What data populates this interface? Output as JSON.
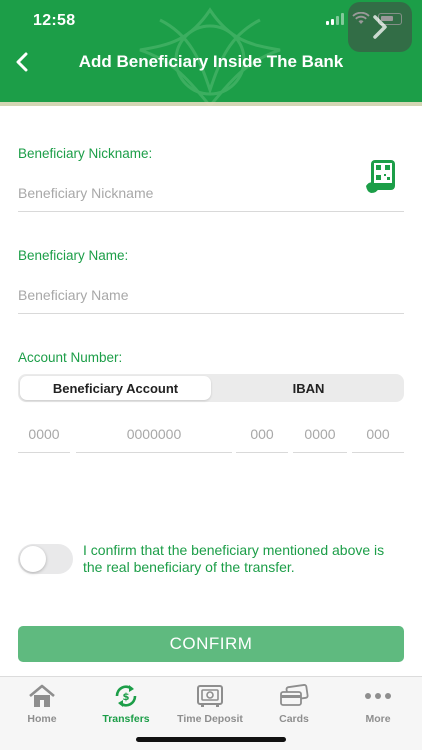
{
  "status_bar": {
    "time": "12:58"
  },
  "header": {
    "title": "Add Beneficiary Inside The Bank"
  },
  "form": {
    "nickname": {
      "label": "Beneficiary Nickname:",
      "placeholder": "Beneficiary Nickname"
    },
    "name": {
      "label": "Beneficiary Name:",
      "placeholder": "Beneficiary Name"
    },
    "account": {
      "label": "Account Number:",
      "segments": [
        {
          "label": "Beneficiary Account",
          "selected": true
        },
        {
          "label": "IBAN",
          "selected": false
        }
      ],
      "parts": [
        {
          "placeholder": "0000"
        },
        {
          "placeholder": "0000000"
        },
        {
          "placeholder": "000"
        },
        {
          "placeholder": "0000"
        },
        {
          "placeholder": "000"
        }
      ]
    },
    "confirmation": {
      "text": "I confirm that the beneficiary mentioned above is the real beneficiary of the transfer.",
      "checked": false
    },
    "confirm_button": "CONFIRM"
  },
  "tabbar": {
    "items": [
      {
        "label": "Home",
        "icon": "home-icon",
        "active": false
      },
      {
        "label": "Transfers",
        "icon": "transfers-icon",
        "active": true
      },
      {
        "label": "Time Deposit",
        "icon": "safe-icon",
        "active": false
      },
      {
        "label": "Cards",
        "icon": "cards-icon",
        "active": false
      },
      {
        "label": "More",
        "icon": "more-icon",
        "active": false
      }
    ]
  },
  "colors": {
    "brand_green": "#1c9e48",
    "button_green": "#5fba7f"
  }
}
